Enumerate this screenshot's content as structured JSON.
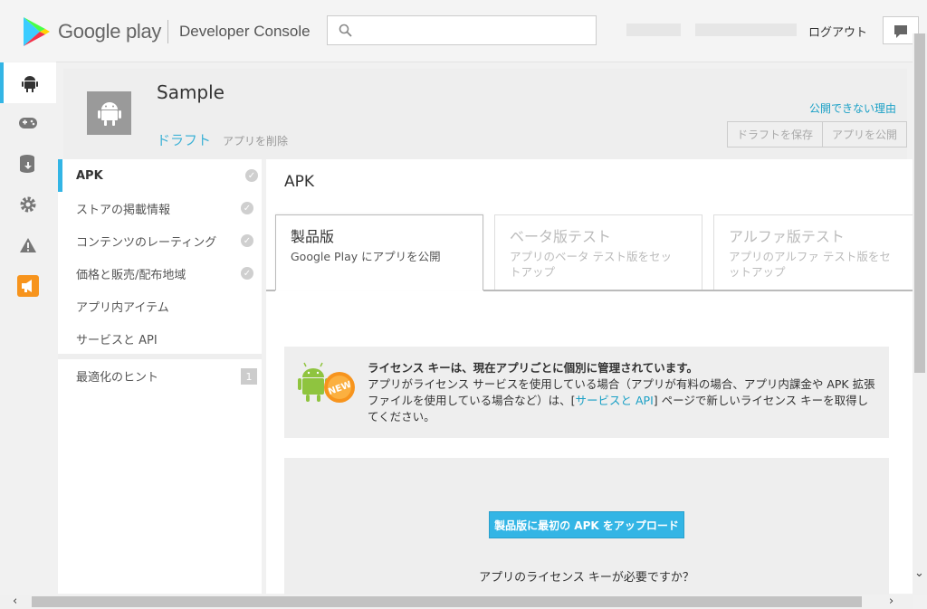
{
  "brand": {
    "play_text": "Google play",
    "console_text": "Developer Console"
  },
  "header_right": {
    "logout": "ログアウト"
  },
  "search": {
    "placeholder": ""
  },
  "app": {
    "name": "Sample",
    "status": "ドラフト",
    "delete": "アプリを削除",
    "why_link": "公開できない理由",
    "save_draft": "ドラフトを保存",
    "publish": "アプリを公開"
  },
  "menu": {
    "items": [
      {
        "label": "APK",
        "checked": true
      },
      {
        "label": "ストアの掲載情報",
        "checked": true
      },
      {
        "label": "コンテンツのレーティング",
        "checked": true
      },
      {
        "label": "価格と販売/配布地域",
        "checked": true
      },
      {
        "label": "アプリ内アイテム",
        "checked": false
      },
      {
        "label": "サービスと API",
        "checked": false
      }
    ],
    "tips": {
      "label": "最適化のヒント",
      "count": "1"
    }
  },
  "main": {
    "title": "APK",
    "tabs": [
      {
        "title": "製品版",
        "sub": "Google Play にアプリを公開"
      },
      {
        "title": "ベータ版テスト",
        "sub": "アプリのベータ テスト版をセットアップ"
      },
      {
        "title": "アルファ版テスト",
        "sub": "アプリのアルファ テスト版をセットアップ"
      }
    ],
    "notice": {
      "bold": "ライセンス キーは、現在アプリごとに個別に管理されています。",
      "line_a": "アプリがライセンス サービスを使用している場合（アプリが有料の場合、アプリ内課金や APK 拡張ファイルを使用している場合など）は、[",
      "link": "サービスと API",
      "line_b": "] ページで新しいライセンス キーを取得してください。",
      "badge": "NEW"
    },
    "upload_button": "製品版に最初の APK をアップロード",
    "license_question": "アプリのライセンス キーが必要ですか？"
  },
  "colors": {
    "accent": "#33b5e5",
    "badge": "#f7941d",
    "link": "#1aa0c6"
  }
}
